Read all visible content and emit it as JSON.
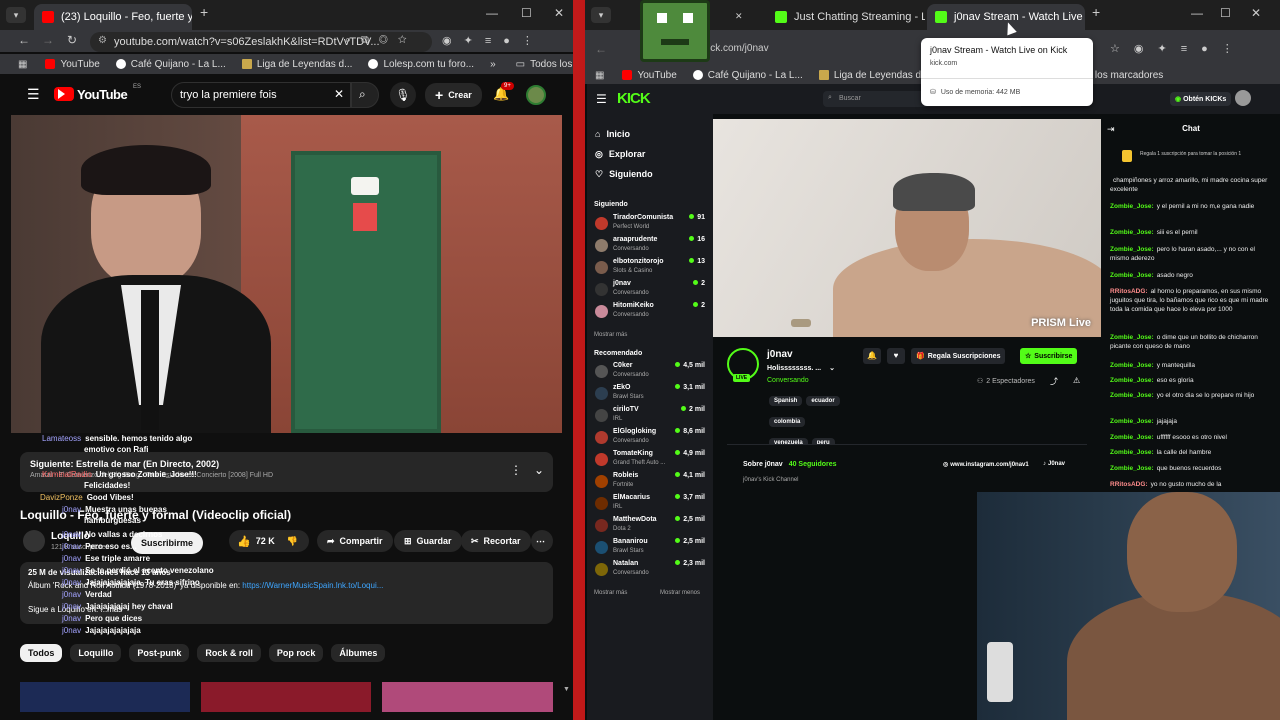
{
  "left_browser": {
    "tab_title": "(23) Loquillo - Feo, fuerte y for...",
    "url": "youtube.com/watch?v=s06ZeslakhK&list=RDtVvTDV...",
    "bookmarks": [
      "YouTube",
      "Café Quijano - La L...",
      "Liga de Leyendas d...",
      "Lolesp.com tu foro..."
    ],
    "all_bookmarks": "Todos los marcadores"
  },
  "youtube": {
    "logo": "YouTube",
    "country": "ES",
    "search_value": "tryo la premiere fois",
    "create_label": "Crear",
    "notif_count": "9+",
    "next_label": "Siguiente: Estrella de mar (En Directo, 2002)",
    "next_sub": "Amaral - El Comienzo del Big Bang - Tour Estadio en Concierto [2008] Full HD",
    "title": "Loquillo - Feo, fuerte y formal (Videoclip oficial)",
    "channel": "Loquillo",
    "subs": "121 K suscriptores",
    "subscribe": "Suscribirme",
    "likes": "72 K",
    "share": "Compartir",
    "save": "Guardar",
    "clip": "Recortar",
    "desc_stats": "25 M de visualizaciones  hace 13 años",
    "desc_text": "Álbum 'Rock and Roll Actitud (1978-2018)' ya disponible en: ",
    "desc_link": "https://WarnerMusicSpain.lnk.to/Loqui...",
    "desc_more": "Sigue a Loquillo en: ...más",
    "chips": [
      "Todos",
      "Loquillo",
      "Post-punk",
      "Rock & roll",
      "Pop rock",
      "Álbumes"
    ]
  },
  "overlay_chat": [
    {
      "user": "Lamateoss",
      "text": "sensible. hemos tenido algo"
    },
    {
      "user": "",
      "text": "emotivo con Rafi"
    },
    {
      "user": "KriminalRadio",
      "text": "Un grosso Zombie_Jose!!!"
    },
    {
      "user": "",
      "text": "Felicidades!"
    },
    {
      "user": "DavizPonze",
      "text": "Good Vibes!"
    },
    {
      "user": "j0nav",
      "text": "Muestra unas buenas"
    },
    {
      "user": "",
      "text": "hamburguesas"
    },
    {
      "user": "j0nav",
      "text": "No vallas a decirnos"
    },
    {
      "user": "j0nav",
      "text": "Pero eso es..."
    },
    {
      "user": "j0nav",
      "text": "Ese triple amarre"
    },
    {
      "user": "j0nav",
      "text": "Se te perdió el acento venezolano"
    },
    {
      "user": "j0nav",
      "text": "Jajajajajajajaja. Tu eras sifrino"
    },
    {
      "user": "j0nav",
      "text": "Verdad"
    },
    {
      "user": "j0nav",
      "text": "Jajajajajajaj hey chaval"
    },
    {
      "user": "j0nav",
      "text": "Pero que dices"
    },
    {
      "user": "j0nav",
      "text": "Jajajajajajajaja"
    }
  ],
  "right_browser": {
    "tabs": [
      "Just Chatting Streaming - Live S",
      "j0nav Stream - Watch Live on K"
    ],
    "url": "kick.com/j0nav",
    "bookmarks": [
      "YouTube",
      "Café Quijano - La L...",
      "Liga de Leyendas d..."
    ],
    "all_bookmarks": "Todos los marcadores",
    "tooltip_title": "j0nav Stream - Watch Live on Kick",
    "tooltip_domain": "kick.com",
    "tooltip_memory": "Uso de memoria: 442 MB"
  },
  "kick": {
    "logo": "KICK",
    "search_placeholder": "Buscar",
    "get_kicks": "Obtén KICKs",
    "nav": [
      "Inicio",
      "Explorar",
      "Siguiendo"
    ],
    "following_header": "Siguiendo",
    "following": [
      {
        "name": "TiradorComunista",
        "cat": "Perfect World",
        "viewers": "91",
        "color": "#c0392b"
      },
      {
        "name": "araaprudente",
        "cat": "Conversando",
        "viewers": "16",
        "color": "#8e7b6b"
      },
      {
        "name": "elbotonzitorojo",
        "cat": "Slots & Casino",
        "viewers": "13",
        "color": "#7a5c4c"
      },
      {
        "name": "j0nav",
        "cat": "Conversando",
        "viewers": "2",
        "color": "#333333"
      },
      {
        "name": "HitomiKeiko",
        "cat": "Conversando",
        "viewers": "2",
        "color": "#c98a9a"
      }
    ],
    "show_more": "Mostrar más",
    "recommended_header": "Recomendado",
    "recommended": [
      {
        "name": "C0ker",
        "cat": "Conversando",
        "viewers": "4,5 mil",
        "color": "#555555"
      },
      {
        "name": "zEkO",
        "cat": "Brawl Stars",
        "viewers": "3,1 mil",
        "color": "#2c3e50"
      },
      {
        "name": "cirilоTV",
        "cat": "IRL",
        "viewers": "2 mil",
        "color": "#444444"
      },
      {
        "name": "ElGlogloking",
        "cat": "Conversando",
        "viewers": "8,6 mil",
        "color": "#b03a2e"
      },
      {
        "name": "TomateKing",
        "cat": "Grand Theft Auto ...",
        "viewers": "4,9 mil",
        "color": "#c0392b"
      },
      {
        "name": "Robleis",
        "cat": "Fortnite",
        "viewers": "4,1 mil",
        "color": "#a04000"
      },
      {
        "name": "ElMacarius",
        "cat": "IRL",
        "viewers": "3,7 mil",
        "color": "#6e2c00"
      },
      {
        "name": "MatthewDota",
        "cat": "Dota 2",
        "viewers": "2,5 mil",
        "color": "#78281f"
      },
      {
        "name": "Bananirou",
        "cat": "Brawl Stars",
        "viewers": "2,5 mil",
        "color": "#1b4f72"
      },
      {
        "name": "Natalan",
        "cat": "Conversando",
        "viewers": "2,3 mil",
        "color": "#7d6608"
      }
    ],
    "show_more2": "Mostrar más",
    "show_less": "Mostrar menos",
    "streamer": "j0nav",
    "stream_title": "Holissssssss. ...",
    "stream_cat": "Conversando",
    "tags": [
      "Spanish",
      "ecuador",
      "colombia",
      "venezuela",
      "peru"
    ],
    "gift_subs": "Regala Suscripciones",
    "subscribe": "Suscribirse",
    "viewers_label": "2 Espectadores",
    "about": "Sobre j0nav",
    "followers": "40 Seguidores",
    "channel_desc": "j0nav's Kick Channel",
    "instagram": "www.instagram.com/j0nav1",
    "tiktok": "J0nav",
    "watermark": "PRISM Live",
    "chat_title": "Chat",
    "pinned": "Regala 1 suscripción para tomar la posición 1",
    "chat": [
      {
        "user": "",
        "text": "champiñones y arroz amarillo, mi madre cocina super excelente"
      },
      {
        "user": "Zombie_Jose:",
        "text": "y el pernil a mi no m,e gana nadie"
      },
      {
        "user": "Zombie_Jose:",
        "text": "siii es el pernil"
      },
      {
        "user": "Zombie_Jose:",
        "text": "pero lo haran asado,... y no con el mismo aderezo"
      },
      {
        "user": "Zombie_Jose:",
        "text": "asado negro"
      },
      {
        "user": "RRitosADG:",
        "text": "al horno lo preparamos, en sus mismo juguitos que tira, lo bañamos que rico es que mi madre toda la comida que hace lo eleva por 1000"
      },
      {
        "user": "Zombie_Jose:",
        "text": "o dime que un bollito de chicharron picante con queso de mano"
      },
      {
        "user": "Zombie_Jose:",
        "text": "y mantequilla"
      },
      {
        "user": "Zombie_Jose:",
        "text": "eso es gloria"
      },
      {
        "user": "Zombie_Jose:",
        "text": "yo el otro dia se lo prepare mi hijo"
      },
      {
        "user": "Zombie_Jose:",
        "text": "jajajaja"
      },
      {
        "user": "Zombie_Jose:",
        "text": "uffffff esooo es otro nivel"
      },
      {
        "user": "Zombie_Jose:",
        "text": "la calle del hambre"
      },
      {
        "user": "Zombie_Jose:",
        "text": "que buenos recuerdos"
      },
      {
        "user": "RRitosADG:",
        "text": "yo no gusto mucho de la"
      }
    ]
  }
}
